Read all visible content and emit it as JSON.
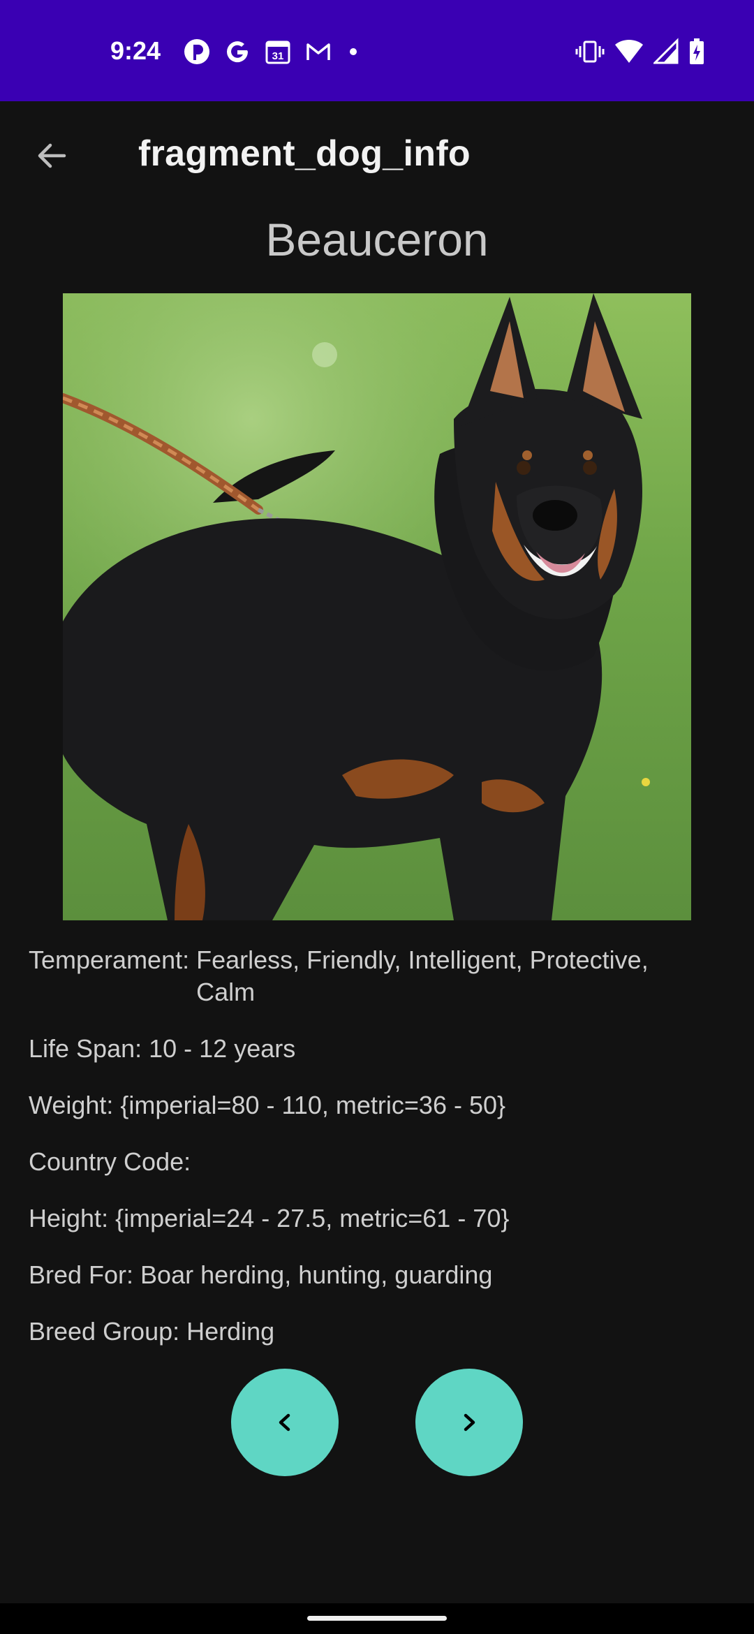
{
  "status_bar": {
    "time": "9:24",
    "calendar_day": "31",
    "left_icons": [
      "p-app-icon",
      "google-icon",
      "calendar-icon",
      "gmail-icon",
      "dot-icon"
    ],
    "right_icons": [
      "vibrate-icon",
      "wifi-icon",
      "signal-icon",
      "battery-charging-icon"
    ],
    "background_color": "#3a00b3"
  },
  "app_bar": {
    "title": "fragment_dog_info",
    "back_icon": "arrow-back-icon"
  },
  "breed": {
    "name": "Beauceron",
    "image_alt": "Beauceron dog photo"
  },
  "details": {
    "temperament_label": "Temperament:",
    "temperament_value": "Fearless, Friendly, Intelligent, Protective, Calm",
    "life_span": "Life Span: 10 - 12 years",
    "weight": "Weight: {imperial=80 - 110, metric=36 - 50}",
    "country_code": "Country Code:",
    "height": "Height: {imperial=24 - 27.5, metric=61 - 70}",
    "bred_for": "Bred For: Boar herding, hunting, guarding",
    "breed_group": "Breed Group: Herding"
  },
  "controls": {
    "previous_icon": "chevron-left-icon",
    "next_icon": "chevron-right-icon",
    "button_color": "#5fd6c4"
  }
}
